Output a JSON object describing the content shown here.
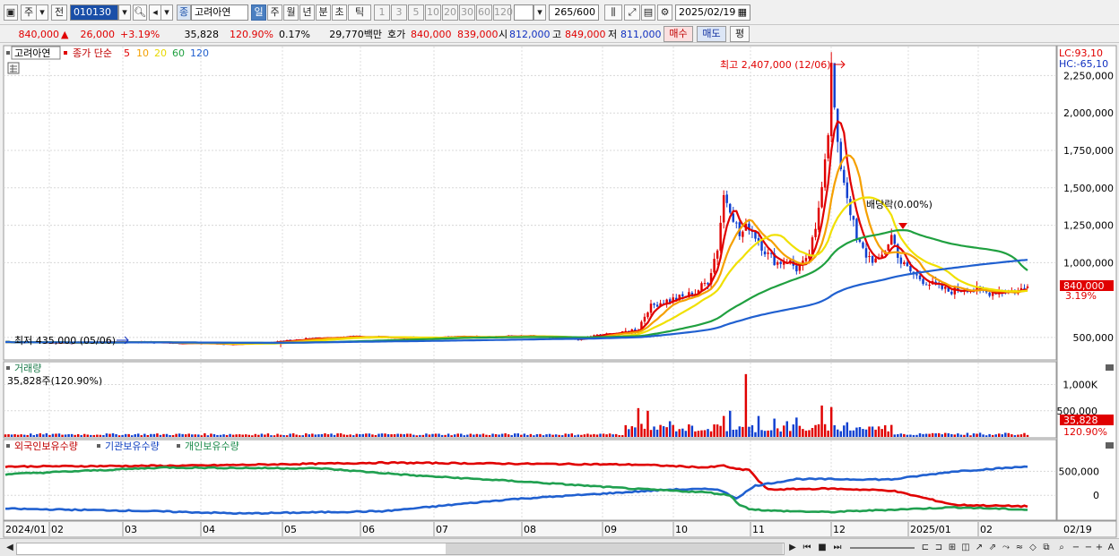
{
  "toolbar": {
    "market_tab": "주",
    "prev_tab": "전",
    "stock_code": "010130",
    "stock_badge": "종",
    "stock_name": "고려아연",
    "period_tabs": [
      "일",
      "주",
      "월",
      "년",
      "분",
      "초",
      "틱"
    ],
    "active_period": "일",
    "interval_buttons": [
      "1",
      "3",
      "5",
      "10",
      "20",
      "30",
      "60",
      "120"
    ],
    "count_value": "265",
    "count_total": "/600",
    "date_value": "2025/02/19"
  },
  "quote": {
    "price": "840,000",
    "change_arrow": "▲",
    "change": "26,000",
    "change_pct": "+3.19%",
    "volume": "35,828",
    "volume_ratio": "120.90%",
    "turnover": "0.17%",
    "amount": "29,770백만",
    "bid_label": "호가",
    "bid_ask": "840,000",
    "bid_bid": "839,000",
    "open_label": "시",
    "open": "812,000",
    "high_label": "고",
    "high": "849,000",
    "low_label": "저",
    "low": "811,000",
    "buy_button": "매수",
    "sell_button": "매도",
    "eval_button": "평"
  },
  "legend": {
    "stock_name": "고려아연",
    "ma_title": "종가 단순",
    "ma_periods": [
      "5",
      "10",
      "20",
      "60",
      "120"
    ],
    "ma_colors": [
      "#e00000",
      "#f5a000",
      "#f0e000",
      "#20a040",
      "#2060d0"
    ],
    "lc_label": "LC:93,10",
    "hc_label": "HC:-65,10"
  },
  "annotations": {
    "high_label": "최고 2,407,000 (12/06)",
    "low_label": "최저 435,000 (05/06)",
    "dividend_label": "배당락(0.00%)",
    "price_tag": "840,000",
    "pct_tag": "3.19%"
  },
  "volume_panel": {
    "title": "거래량",
    "value_label": "35,828주(120.90%)",
    "tag": "35,828",
    "pct_tag": "120.90%",
    "y_ticks": [
      "1,000K",
      "500,000"
    ]
  },
  "holdings_panel": {
    "legend": [
      "외국인보유수량",
      "기관보유수량",
      "개인보유수량"
    ],
    "colors": [
      "#e00000",
      "#2060d0",
      "#20a050"
    ],
    "y_ticks": [
      "500,000",
      "0"
    ]
  },
  "x_axis": {
    "labels": [
      "2024/01",
      "02",
      "03",
      "04",
      "05",
      "06",
      "07",
      "08",
      "09",
      "10",
      "11",
      "12",
      "2025/01",
      "02"
    ],
    "end_label": "02/19"
  },
  "chart_data": {
    "type": "candlestick",
    "price_range": [
      350000,
      2450000
    ],
    "y_ticks": [
      2250000,
      2000000,
      1750000,
      1500000,
      1250000,
      1000000,
      500000
    ],
    "y_tick_labels": [
      "2,250,000",
      "2,000,000",
      "1,750,000",
      "1,500,000",
      "1,250,000",
      "1,000,000",
      "500,000"
    ],
    "x_months": [
      "2024/01",
      "02",
      "03",
      "04",
      "05",
      "06",
      "07",
      "08",
      "09",
      "10",
      "11",
      "12",
      "2025/01",
      "02"
    ],
    "close_anchors": [
      [
        0,
        470000
      ],
      [
        20,
        465000
      ],
      [
        40,
        470000
      ],
      [
        60,
        462000
      ],
      [
        75,
        455000
      ],
      [
        85,
        470000
      ],
      [
        95,
        490000
      ],
      [
        110,
        505000
      ],
      [
        130,
        500000
      ],
      [
        150,
        505000
      ],
      [
        165,
        508000
      ],
      [
        175,
        495000
      ],
      [
        181,
        485000
      ],
      [
        185,
        510000
      ],
      [
        193,
        530000
      ],
      [
        197,
        540000
      ],
      [
        200,
        560000
      ],
      [
        203,
        690000
      ],
      [
        206,
        730000
      ],
      [
        210,
        750000
      ],
      [
        214,
        770000
      ],
      [
        218,
        800000
      ],
      [
        222,
        880000
      ],
      [
        225,
        1100000
      ],
      [
        227,
        1450000
      ],
      [
        229,
        1380000
      ],
      [
        232,
        1180000
      ],
      [
        235,
        1250000
      ],
      [
        238,
        1150000
      ],
      [
        241,
        1050000
      ],
      [
        244,
        1000000
      ],
      [
        247,
        1020000
      ],
      [
        250,
        960000
      ],
      [
        253,
        1000000
      ],
      [
        256,
        1200000
      ],
      [
        258,
        1550000
      ],
      [
        260,
        1900000
      ],
      [
        261,
        2300000
      ],
      [
        263,
        1750000
      ],
      [
        266,
        1450000
      ],
      [
        269,
        1150000
      ],
      [
        272,
        1050000
      ],
      [
        276,
        1000000
      ],
      [
        280,
        1180000
      ],
      [
        283,
        1000000
      ],
      [
        287,
        920000
      ],
      [
        292,
        860000
      ],
      [
        298,
        810000
      ],
      [
        304,
        830000
      ],
      [
        310,
        800000
      ],
      [
        315,
        815000
      ],
      [
        320,
        810000
      ],
      [
        323,
        840000
      ]
    ],
    "total_days": 324,
    "high": {
      "value": 2407000,
      "date": "12/06"
    },
    "low": {
      "value": 435000,
      "date": "05/06"
    },
    "last_close": 840000,
    "moving_averages": [
      {
        "name": "5",
        "color": "#e00000"
      },
      {
        "name": "10",
        "color": "#f5a000"
      },
      {
        "name": "20",
        "color": "#f0e000"
      },
      {
        "name": "60",
        "color": "#20a040"
      },
      {
        "name": "120",
        "color": "#2060d0"
      }
    ],
    "volume_range": [
      0,
      1300000
    ],
    "volume_ticks": [
      1000000,
      500000
    ],
    "volume_spikes": [
      [
        200,
        550000
      ],
      [
        203,
        500000
      ],
      [
        210,
        300000
      ],
      [
        227,
        400000
      ],
      [
        229,
        500000
      ],
      [
        234,
        1200000
      ],
      [
        238,
        400000
      ],
      [
        243,
        350000
      ],
      [
        247,
        300000
      ],
      [
        250,
        370000
      ],
      [
        258,
        600000
      ],
      [
        261,
        570000
      ],
      [
        266,
        280000
      ],
      [
        276,
        200000
      ]
    ],
    "holdings_range": [
      -500000,
      900000
    ],
    "foreign_anchors": [
      [
        0,
        600000
      ],
      [
        60,
        620000
      ],
      [
        120,
        680000
      ],
      [
        160,
        660000
      ],
      [
        200,
        640000
      ],
      [
        222,
        580000
      ],
      [
        227,
        620000
      ],
      [
        230,
        560000
      ],
      [
        233,
        530000
      ],
      [
        235,
        540000
      ],
      [
        238,
        300000
      ],
      [
        241,
        120000
      ],
      [
        260,
        140000
      ],
      [
        280,
        100000
      ],
      [
        300,
        -200000
      ],
      [
        323,
        -230000
      ]
    ],
    "institution_anchors": [
      [
        0,
        -280000
      ],
      [
        40,
        -320000
      ],
      [
        75,
        -380000
      ],
      [
        120,
        -330000
      ],
      [
        160,
        -80000
      ],
      [
        190,
        40000
      ],
      [
        210,
        120000
      ],
      [
        225,
        130000
      ],
      [
        231,
        -60000
      ],
      [
        237,
        200000
      ],
      [
        250,
        340000
      ],
      [
        280,
        330000
      ],
      [
        300,
        500000
      ],
      [
        323,
        600000
      ]
    ],
    "individual_anchors": [
      [
        0,
        440000
      ],
      [
        50,
        580000
      ],
      [
        100,
        560000
      ],
      [
        130,
        410000
      ],
      [
        160,
        300000
      ],
      [
        200,
        130000
      ],
      [
        222,
        60000
      ],
      [
        229,
        0
      ],
      [
        232,
        -200000
      ],
      [
        235,
        -280000
      ],
      [
        241,
        -320000
      ],
      [
        260,
        -350000
      ],
      [
        300,
        -250000
      ],
      [
        323,
        -300000
      ]
    ]
  }
}
